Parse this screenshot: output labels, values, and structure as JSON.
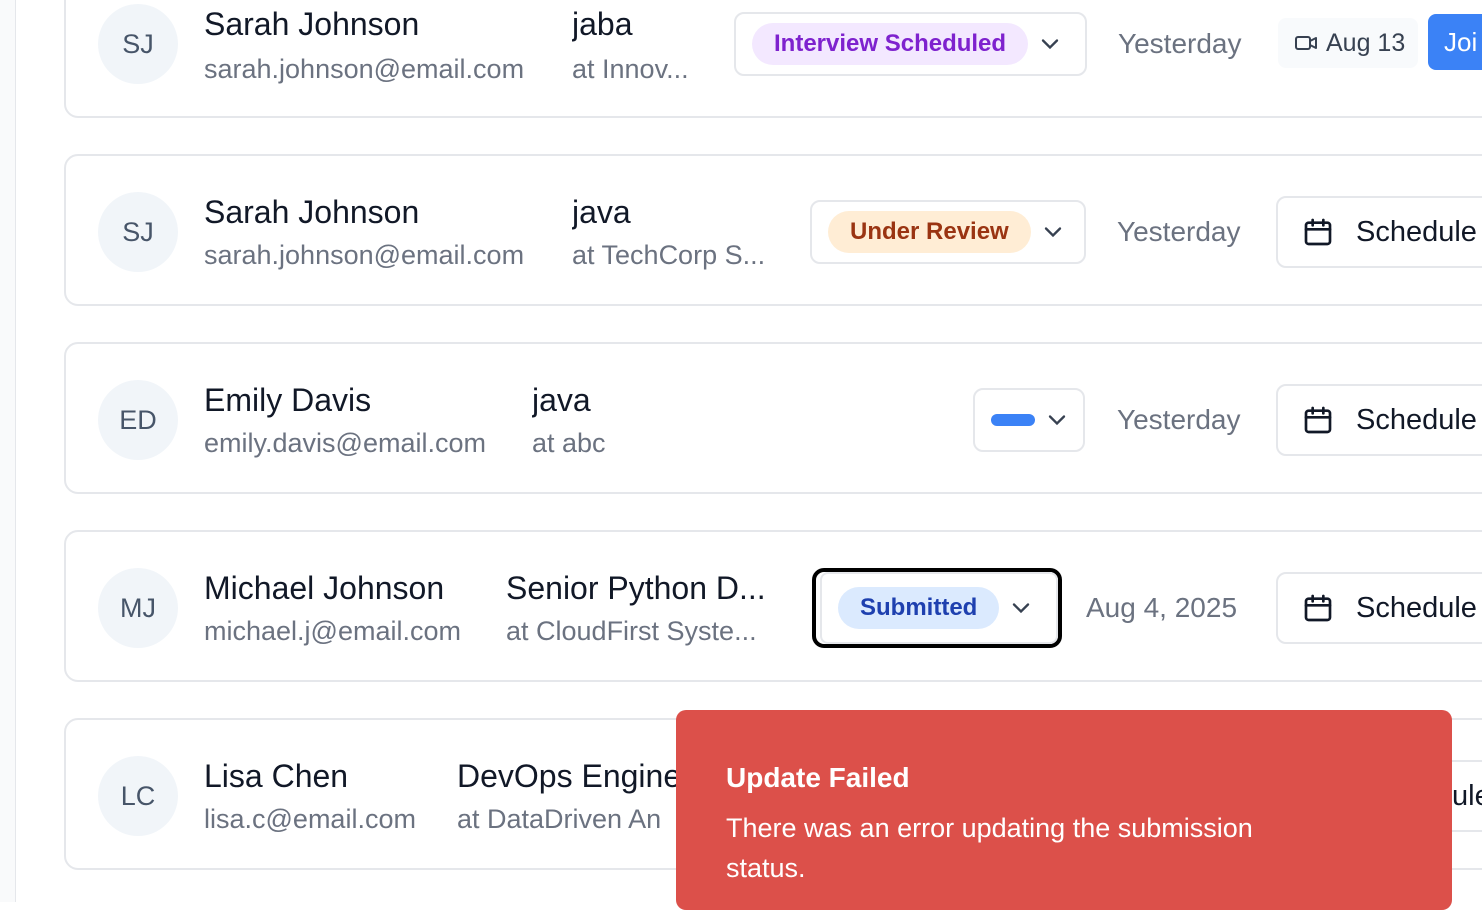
{
  "submissions": [
    {
      "initials": "SJ",
      "name": "Sarah Johnson",
      "email": "sarah.johnson@email.com",
      "job": "jaba",
      "company": "at Innov...",
      "status": "Interview Scheduled",
      "date": "Yesterday",
      "interview_date": "Aug 13",
      "join_label": "Joi"
    },
    {
      "initials": "SJ",
      "name": "Sarah Johnson",
      "email": "sarah.johnson@email.com",
      "job": "java",
      "company": "at TechCorp S...",
      "status": "Under Review",
      "date": "Yesterday",
      "action_label": "Schedule"
    },
    {
      "initials": "ED",
      "name": "Emily Davis",
      "email": "emily.davis@email.com",
      "job": "java",
      "company": "at abc",
      "status": "",
      "date": "Yesterday",
      "action_label": "Schedule"
    },
    {
      "initials": "MJ",
      "name": "Michael Johnson",
      "email": "michael.j@email.com",
      "job": "Senior Python D...",
      "company": "at CloudFirst Syste...",
      "status": "Submitted",
      "date": "Aug 4, 2025",
      "action_label": "Schedule"
    },
    {
      "initials": "LC",
      "name": "Lisa Chen",
      "email": "lisa.c@email.com",
      "job": "DevOps Engine",
      "company": "at DataDriven An",
      "action_label": "ule"
    }
  ],
  "toast": {
    "title": "Update Failed",
    "message": "There was an error updating the submission status."
  },
  "colors": {
    "interview_badge_bg": "#f3e8ff",
    "interview_badge_fg": "#7e22ce",
    "review_badge_bg": "#ffedd5",
    "review_badge_fg": "#9a3412",
    "submitted_badge_bg": "#dbeafe",
    "submitted_badge_fg": "#1e40af",
    "primary": "#3b82f6",
    "toast_bg": "#dc504a"
  },
  "icons": [
    "video-icon",
    "calendar-icon",
    "chevron-down-icon"
  ]
}
